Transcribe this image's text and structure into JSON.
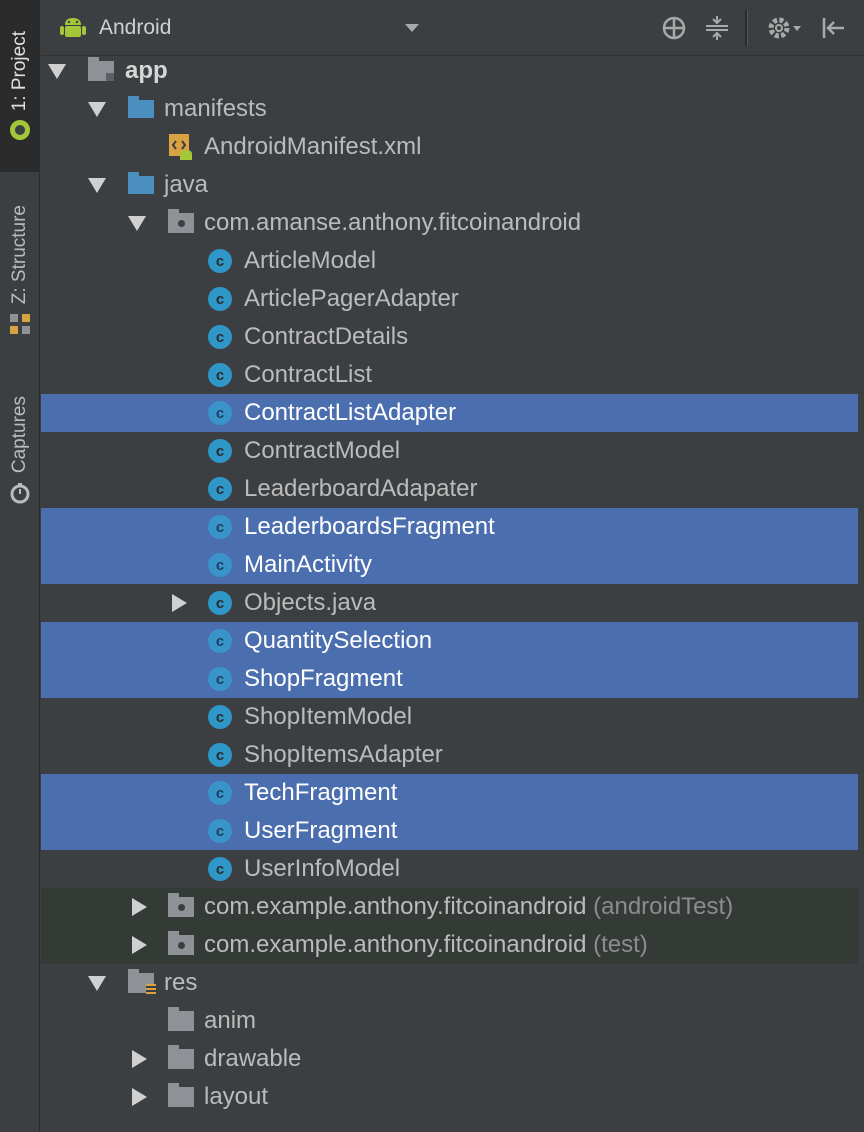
{
  "side_tabs": {
    "project": "1: Project",
    "structure": "Z: Structure",
    "captures": "Captures"
  },
  "toolbar": {
    "view_mode": "Android"
  },
  "tree": {
    "app": "app",
    "manifests": "manifests",
    "android_manifest": "AndroidManifest.xml",
    "java": "java",
    "package_main": "com.amanse.anthony.fitcoinandroid",
    "classes": [
      "ArticleModel",
      "ArticlePagerAdapter",
      "ContractDetails",
      "ContractList",
      "ContractListAdapter",
      "ContractModel",
      "LeaderboardAdapater",
      "LeaderboardsFragment",
      "MainActivity",
      "Objects.java",
      "QuantitySelection",
      "ShopFragment",
      "ShopItemModel",
      "ShopItemsAdapter",
      "TechFragment",
      "UserFragment",
      "UserInfoModel"
    ],
    "class_icon_letter": "c",
    "package_android_test": "com.example.anthony.fitcoinandroid",
    "package_android_test_suffix": "(androidTest)",
    "package_test": "com.example.anthony.fitcoinandroid",
    "package_test_suffix": "(test)",
    "res": "res",
    "res_children": [
      "anim",
      "drawable",
      "layout"
    ]
  },
  "colors": {
    "selection": "#4b6eaf",
    "background": "#3c3f41",
    "class_icon": "#2f97c8",
    "folder_blue": "#4a8fc0",
    "android_green": "#a4c639"
  }
}
